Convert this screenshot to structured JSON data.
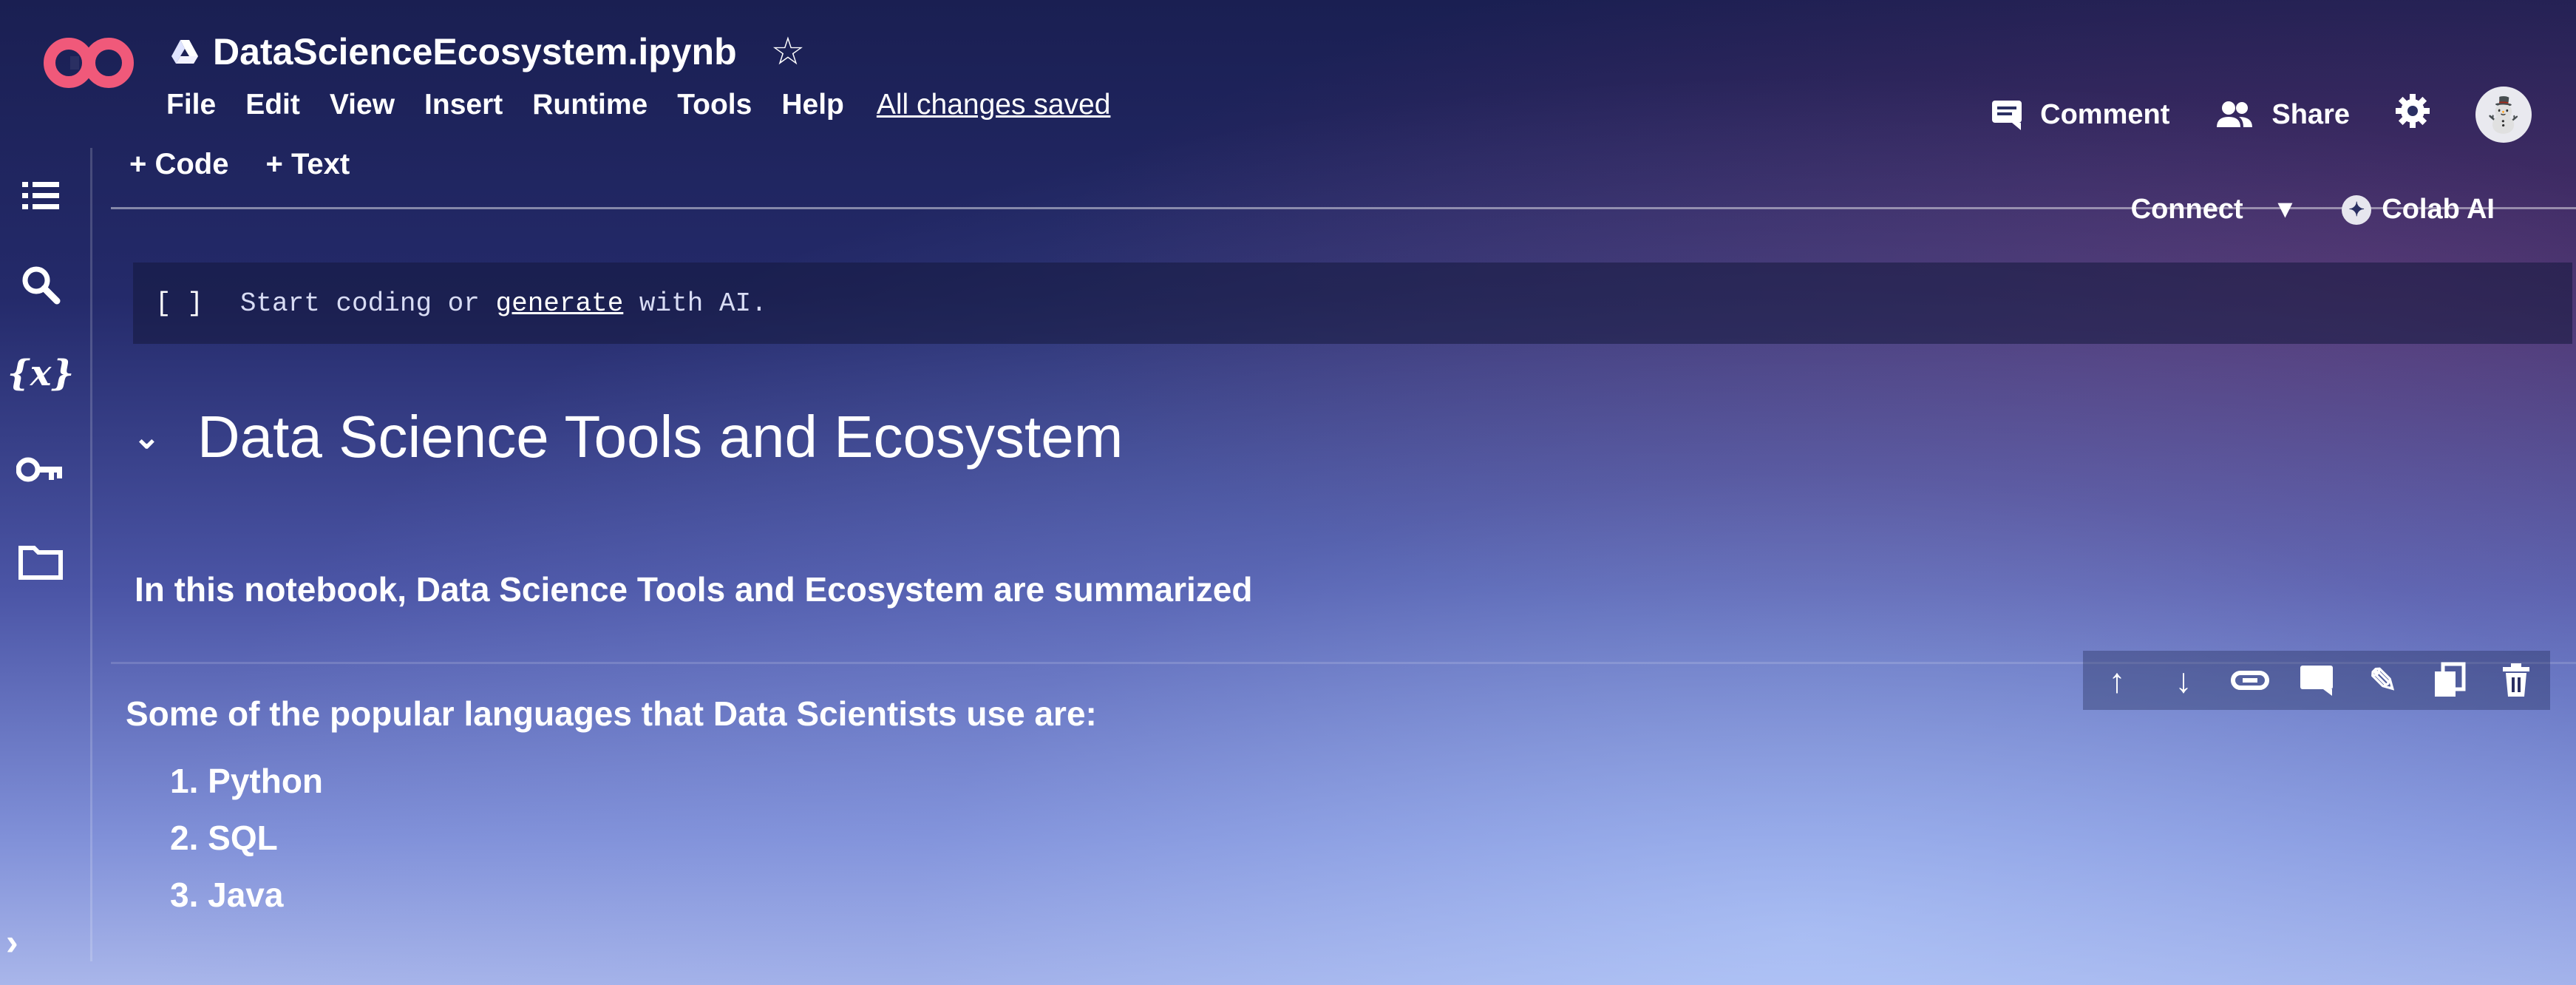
{
  "app": {
    "logo_text": "CO",
    "doc_title": "DataScienceEcosystem.ipynb",
    "star_icon": "star-icon",
    "drive_icon": "google-drive-icon"
  },
  "menu": {
    "items": [
      "File",
      "Edit",
      "View",
      "Insert",
      "Runtime",
      "Tools",
      "Help"
    ],
    "save_status": "All changes saved"
  },
  "header_actions": {
    "comment_label": "Comment",
    "share_label": "Share",
    "settings_icon": "gear-icon",
    "avatar_icon": "user-avatar-icon"
  },
  "toolbar": {
    "add_code_label": "+ Code",
    "add_text_label": "+ Text",
    "connect_label": "Connect",
    "colab_ai_label": "Colab AI"
  },
  "sidebar": {
    "icons": [
      "table-of-contents-icon",
      "search-icon",
      "variables-icon",
      "key-icon",
      "folder-icon"
    ],
    "variables_text": "{x}"
  },
  "code_cell": {
    "bracket": "[ ]",
    "prefix": "Start coding or",
    "link": "generate",
    "suffix": "with AI."
  },
  "notebook": {
    "heading": "Data Science Tools and Ecosystem",
    "intro": "In this notebook, Data Science Tools and Ecosystem are summarized",
    "languages_title": "Some of the popular languages that Data Scientists use are:",
    "languages": [
      "1. Python",
      "2. SQL",
      "3. Java"
    ]
  },
  "cell_toolbar": {
    "icons": [
      "move-up-icon",
      "move-down-icon",
      "link-icon",
      "comment-icon",
      "edit-icon",
      "mirror-cell-icon",
      "delete-icon"
    ]
  },
  "colors": {
    "background_top": "#1a1f52",
    "background_bottom": "#a9b6ea",
    "logo_pink": "#f0597a",
    "text": "#ffffff"
  }
}
